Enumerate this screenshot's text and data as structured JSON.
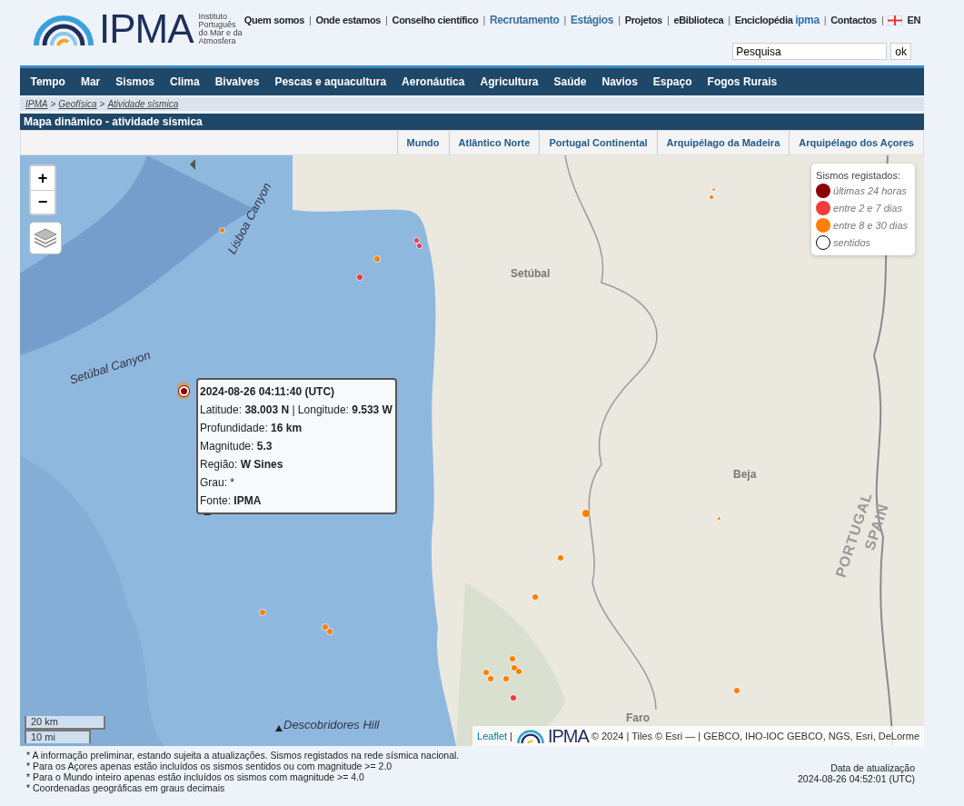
{
  "logo": {
    "wordmark": "IPMA",
    "subtitle": [
      "Instituto",
      "Português",
      "do Mar e da",
      "Atmosfera"
    ]
  },
  "top_links": [
    {
      "label": "Quem somos",
      "kind": "plain"
    },
    {
      "label": "Onde estamos",
      "kind": "plain"
    },
    {
      "label": "Conselho científico",
      "kind": "plain"
    },
    {
      "label": "Recrutamento",
      "kind": "highlight"
    },
    {
      "label": "Estágios",
      "kind": "highlight"
    },
    {
      "label": "Projetos",
      "kind": "plain"
    },
    {
      "label": "eBiblioteca",
      "kind": "plain"
    },
    {
      "label": "Enciclopédia",
      "suffix": "ipma",
      "kind": "plain"
    },
    {
      "label": "Contactos",
      "kind": "plain"
    }
  ],
  "link_separator": "|",
  "language": "EN",
  "search": {
    "value": "Pesquisa",
    "button": "ok"
  },
  "nav": [
    "Tempo",
    "Mar",
    "Sismos",
    "Clima",
    "Bivalves",
    "Pescas e aquacultura",
    "Aeronáutica",
    "Agricultura",
    "Saúde",
    "Navios",
    "Espaço",
    "Fogos Rurais"
  ],
  "breadcrumb": [
    "IPMA",
    "Geofísica",
    "Atividade sísmica"
  ],
  "breadcrumb_separator": ">",
  "page_title": "Mapa dinâmico - atividade sísmica",
  "region_tabs": [
    "Mundo",
    "Atlântico Norte",
    "Portugal Continental",
    "Arquipélago da Madeira",
    "Arquipélago dos Açores"
  ],
  "map": {
    "zoom_in": "+",
    "zoom_out": "−",
    "legend": {
      "title": "Sismos registados:",
      "items": [
        {
          "label": "últimas 24 horas",
          "color": "#8b0000",
          "kind": "filled"
        },
        {
          "label": "entre 2 e 7 dias",
          "color": "#f03c3c",
          "kind": "filled"
        },
        {
          "label": "entre 8 e 30 dias",
          "color": "#ff8000",
          "kind": "filled"
        },
        {
          "label": "sentidos",
          "color": "#000000",
          "kind": "outline"
        }
      ]
    },
    "labels": [
      {
        "text": "Lisboa Canyon",
        "kind": "feature"
      },
      {
        "text": "Setúbal Canyon",
        "kind": "feature"
      },
      {
        "text": "Setúbal",
        "kind": "city"
      },
      {
        "text": "Beja",
        "kind": "city"
      },
      {
        "text": "Faro",
        "kind": "city"
      },
      {
        "text": "PORTUGAL",
        "kind": "border"
      },
      {
        "text": "SPAIN",
        "kind": "border"
      },
      {
        "text": "Descobridores Hill",
        "kind": "feature"
      }
    ],
    "popup": {
      "title": "2024-08-26 04:11:40 (UTC)",
      "lines": [
        "Latitude: **38.003 N** | Longitude: **9.533 W**",
        "Profundidade: **16 km**",
        "Magnitude: **5.3**",
        "Região: **W Sines**",
        "Grau: *",
        "Fonte: **IPMA**"
      ]
    },
    "scale": [
      "20 km",
      "10 mi"
    ],
    "attribution": {
      "link": "Leaflet",
      "separator": "|",
      "logo": "IPMA",
      "text": "© 2024 | Tiles © Esri — | GEBCO, IHO-IOC GEBCO, NGS, Esri, DeLorme"
    }
  },
  "notes": [
    "* A informação preliminar, estando sujeita a atualizações. Sismos registados na rede sísmica nacional.",
    "* Para os Açores apenas estão incluídos os sismos sentidos ou com magnitude >= 2.0",
    "* Para o Mundo inteiro apenas estão incluídos os sismos com magnitude >= 4.0",
    "* Coordenadas geográficas em graus decimais"
  ],
  "update": {
    "label": "Data de atualização",
    "value": "2024-08-26 04:52:01 (UTC)"
  }
}
